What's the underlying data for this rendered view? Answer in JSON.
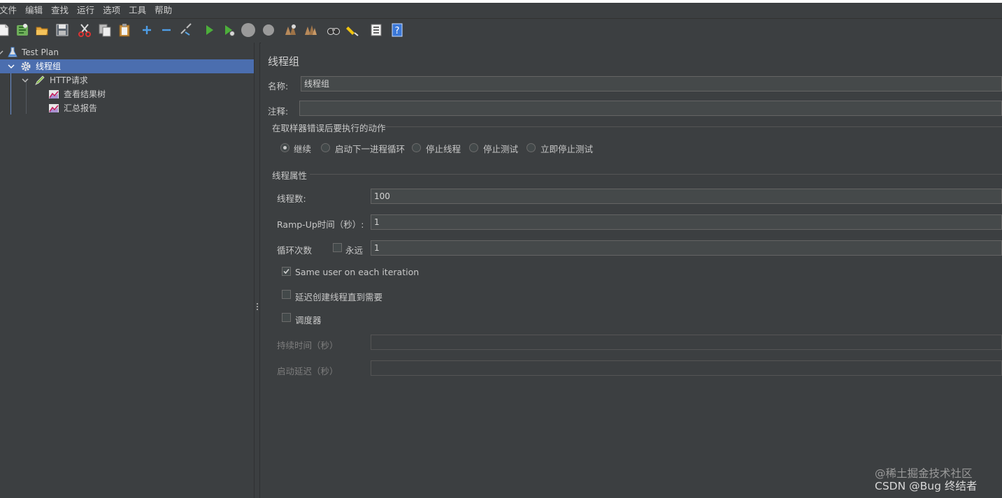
{
  "menu": [
    "文件",
    "编辑",
    "查找",
    "运行",
    "选项",
    "工具",
    "帮助"
  ],
  "toolbar": {
    "icons": [
      "new-icon",
      "templates-icon",
      "open-icon",
      "save-icon",
      "cut-icon",
      "copy-icon",
      "paste-icon",
      "expand-icon",
      "collapse-icon",
      "toggle-icon",
      "start-icon",
      "start-no-pause-icon",
      "stop-icon",
      "shutdown-icon",
      "clear-icon",
      "clear-all-icon",
      "search-icon",
      "reset-search-icon",
      "function-helper-icon",
      "help-icon"
    ]
  },
  "tree": {
    "items": [
      {
        "label": "Test Plan",
        "icon": "test-plan-icon"
      },
      {
        "label": "线程组",
        "icon": "thread-group-gear-icon"
      },
      {
        "label": "HTTP请求",
        "icon": "sampler-pen-icon"
      },
      {
        "label": "查看结果树",
        "icon": "listener-chart-icon"
      },
      {
        "label": "汇总报告",
        "icon": "listener-chart-icon"
      }
    ],
    "selected_index": 1
  },
  "form": {
    "title": "线程组",
    "name_label": "名称:",
    "name_value": "线程组",
    "comment_label": "注释:",
    "comment_value": "",
    "error_section_title": "在取样器错误后要执行的动作",
    "error_actions": [
      "继续",
      "启动下一进程循环",
      "停止线程",
      "停止测试",
      "立即停止测试"
    ],
    "error_action_selected": 0,
    "thread_props_title": "线程属性",
    "threads_label": "线程数:",
    "threads_value": "100",
    "rampup_label": "Ramp-Up时间（秒）:",
    "rampup_value": "1",
    "loop_label": "循环次数",
    "forever_label": "永远",
    "forever_checked": false,
    "loop_value": "1",
    "same_user_label": "Same user on each iteration",
    "same_user_checked": true,
    "delay_create_label": "延迟创建线程直到需要",
    "delay_create_checked": false,
    "scheduler_label": "调度器",
    "scheduler_checked": false,
    "duration_label": "持续时间（秒）",
    "duration_value": "",
    "startup_delay_label": "启动延迟（秒）",
    "startup_delay_value": ""
  },
  "watermark": {
    "line1": "@稀土掘金技术社区",
    "line2": "CSDN @Bug 终结者"
  },
  "colors": {
    "background": "#3c3f41",
    "selection": "#4b6eaf",
    "field": "#45494a"
  }
}
